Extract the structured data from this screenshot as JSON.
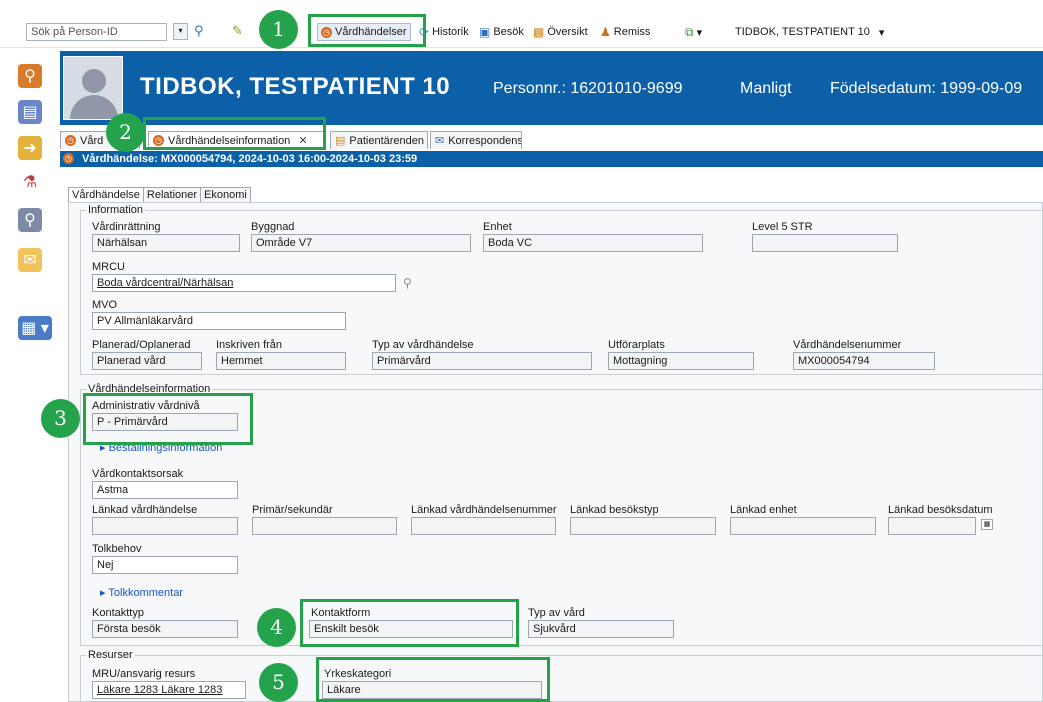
{
  "toolbar": {
    "search_placeholder": "Sök på Person-ID",
    "items": [
      {
        "label": "Vårdhändelser",
        "icon": "clock-icon"
      },
      {
        "label": "Historik",
        "icon": "history-icon"
      },
      {
        "label": "Besök",
        "icon": "book-icon"
      },
      {
        "label": "Översikt",
        "icon": "overview-icon"
      },
      {
        "label": "Remiss",
        "icon": "referral-icon"
      }
    ],
    "patient_selector": "TIDBOK, TESTPATIENT 10"
  },
  "patient": {
    "name": "TIDBOK, TESTPATIENT 10",
    "personnr": "Personnr.: 16201010-9699",
    "gender": "Manligt",
    "birthdate": "Födelsedatum: 1999-09-09"
  },
  "tabs": [
    {
      "label": "Vård"
    },
    {
      "label": "Vårdhändelseinformation"
    },
    {
      "label": "Patientärenden"
    },
    {
      "label": "Korrespondens"
    }
  ],
  "event_bar": "Vårdhändelse: MX000054794, 2024-10-03 16:00-2024-10-03 23:59",
  "subtabs": [
    "Vårdhändelse",
    "Relationer",
    "Ekonomi"
  ],
  "information": {
    "title": "Information",
    "vardinrattning": {
      "label": "Vårdinrättning",
      "value": "Närhälsan"
    },
    "byggnad": {
      "label": "Byggnad",
      "value": "Område V7"
    },
    "enhet": {
      "label": "Enhet",
      "value": "Boda VC"
    },
    "level5": {
      "label": "Level 5 STR",
      "value": ""
    },
    "mrcu": {
      "label": "MRCU",
      "value": "Boda vårdcentral/Närhälsan"
    },
    "mvo": {
      "label": "MVO",
      "value": "PV Allmänläkarvård"
    },
    "planerad": {
      "label": "Planerad/Oplanerad",
      "value": "Planerad vård"
    },
    "inskriven": {
      "label": "Inskriven från",
      "value": "Hemmet"
    },
    "typ_vardhandelse": {
      "label": "Typ av vårdhändelse",
      "value": "Primärvård"
    },
    "utforarplats": {
      "label": "Utförarplats",
      "value": "Mottagning"
    },
    "vardhandelsenummer": {
      "label": "Vårdhändelsenummer",
      "value": "MX000054794"
    }
  },
  "vardinfo": {
    "title": "Vårdhändelseinformation",
    "admin_niva": {
      "label": "Administrativ vårdnivå",
      "value": "P - Primärvård"
    },
    "bestallning": "Beställningsinformation",
    "kontaktorsak": {
      "label": "Vårdkontaktsorsak",
      "value": "Astma"
    },
    "lankad_vardhandelse": {
      "label": "Länkad vårdhändelse",
      "value": ""
    },
    "primar_sekundar": {
      "label": "Primär/sekundär",
      "value": ""
    },
    "lankad_nummer": {
      "label": "Länkad vårdhändelsenummer",
      "value": ""
    },
    "lankad_besokstyp": {
      "label": "Länkad besökstyp",
      "value": ""
    },
    "lankad_enhet": {
      "label": "Länkad enhet",
      "value": ""
    },
    "lankad_datum": {
      "label": "Länkad besöksdatum",
      "value": ""
    },
    "tolkbehov": {
      "label": "Tolkbehov",
      "value": "Nej"
    },
    "tolkkommentar": "Tolkkommentar",
    "kontakttyp": {
      "label": "Kontakttyp",
      "value": "Första besök"
    },
    "kontaktform": {
      "label": "Kontaktform",
      "value": "Enskilt besök"
    },
    "typ_av_vard": {
      "label": "Typ av vård",
      "value": "Sjukvård"
    }
  },
  "resurser": {
    "title": "Resurser",
    "mru": {
      "label": "MRU/ansvarig resurs",
      "value": "Läkare 1283 Läkare 1283"
    },
    "yrkeskategori": {
      "label": "Yrkeskategori",
      "value": "Läkare"
    }
  },
  "callouts": [
    "1",
    "2",
    "3",
    "4",
    "5"
  ],
  "colors": {
    "header_blue": "#0b60a8",
    "highlight_green": "#23a24a"
  }
}
